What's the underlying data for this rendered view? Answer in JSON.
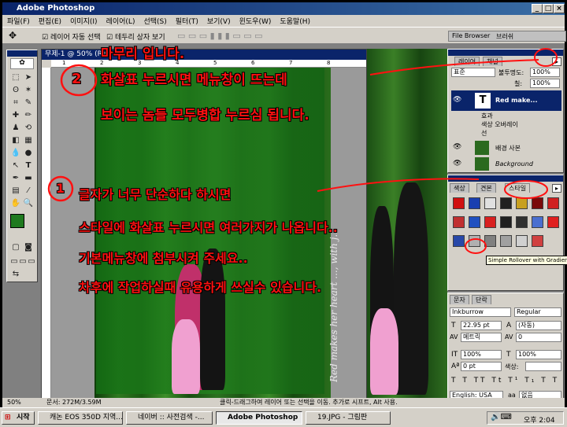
{
  "app": {
    "title": "Adobe Photoshop"
  },
  "menu": [
    "파일(F)",
    "편집(E)",
    "이미지(I)",
    "레이어(L)",
    "선택(S)",
    "필터(T)",
    "보기(V)",
    "윈도우(W)",
    "도움말(H)"
  ],
  "options": {
    "auto_select": "레이어 자동 선택",
    "show_bounds": "테두리 상자 보기"
  },
  "palette_well": {
    "file_browser": "File Browser",
    "brushes": "브러쉬"
  },
  "document": {
    "title": "무제-1 @ 50% (Red ...",
    "ruler_marks": [
      "1",
      "2",
      "3",
      "4",
      "5",
      "6",
      "7",
      "8"
    ],
    "vertical_text": "Red makes her heart ..., with j..."
  },
  "layers_panel": {
    "tabs": [
      "레이어",
      "채널"
    ],
    "blend_mode": "표준",
    "opacity_label": "불투명도:",
    "opacity": "100%",
    "fill_label": "칠:",
    "fill": "100%",
    "layers": [
      {
        "name": "Red make...",
        "type": "text"
      },
      {
        "name": "효과",
        "type": "effect"
      },
      {
        "name": "색상 오버레이",
        "type": "effect"
      },
      {
        "name": "선",
        "type": "effect"
      },
      {
        "name": "배경 사본",
        "type": "image"
      },
      {
        "name": "Background",
        "type": "image"
      }
    ]
  },
  "styles_panel": {
    "tabs": [
      "색상",
      "견본",
      "스타일"
    ],
    "tooltip": "Simple Rollover with Gradient",
    "swatches": [
      "#d01010",
      "#1a3fb0",
      "#e0e0e0",
      "#202020",
      "#c8a020",
      "#7a0a0a",
      "#d02020",
      "#c03030",
      "#2050c0",
      "#d82020",
      "#202020",
      "#303030",
      "#4a6fd0",
      "#e02020",
      "#2848a8",
      "#b0b0b0",
      "#808080",
      "#a0a0a0",
      "#d0d0d0",
      "#d04040"
    ]
  },
  "character_panel": {
    "tabs": [
      "문자",
      "단락"
    ],
    "font": "Inkburrow",
    "style": "Regular",
    "size": "22.95 pt",
    "leading": "(자동)",
    "kerning": "메트릭",
    "tracking": "0",
    "vscale": "100%",
    "hscale": "100%",
    "baseline": "0 pt",
    "color_label": "색상:",
    "language": "English: USA",
    "aa": "없음"
  },
  "status": {
    "zoom": "50%",
    "doc": "문서: 272M/3.59M",
    "hint": "클릭-드래그하여 레이어 또는 선택을 이동. 추가로 시프트, Alt 사용."
  },
  "taskbar": {
    "start": "시작",
    "tasks": [
      "캐논 EOS 350D 지역...",
      "네이버 :: 사전검색 -...",
      "Adobe Photoshop",
      "19.JPG - 그림판"
    ],
    "clock": "오후 2:04"
  },
  "annotations": {
    "title": "마무리 입니다.",
    "step2_marker": "2",
    "step2_line1": "화살표 누르시면 메뉴창이 뜨는데",
    "step2_line2": "보이는 놈들 모두병합 누르심 됩니다.",
    "step1_marker": "1",
    "step1_line1": "글자가 너무 단순하다 하시면",
    "step1_line2": "스타일에 화살표 누르시면 여러가지가 나옵니다..",
    "step1_line3": "기본메뉴창에 첨부시켜 주세요..",
    "step1_line4": "차후에 작업하실때 유용하게 쓰실수 있습니다."
  },
  "colors": {
    "annotation": "#ff1111",
    "titlebar": "#0a246a",
    "foreground": "#1f7a1f",
    "background": "#ffffff"
  }
}
